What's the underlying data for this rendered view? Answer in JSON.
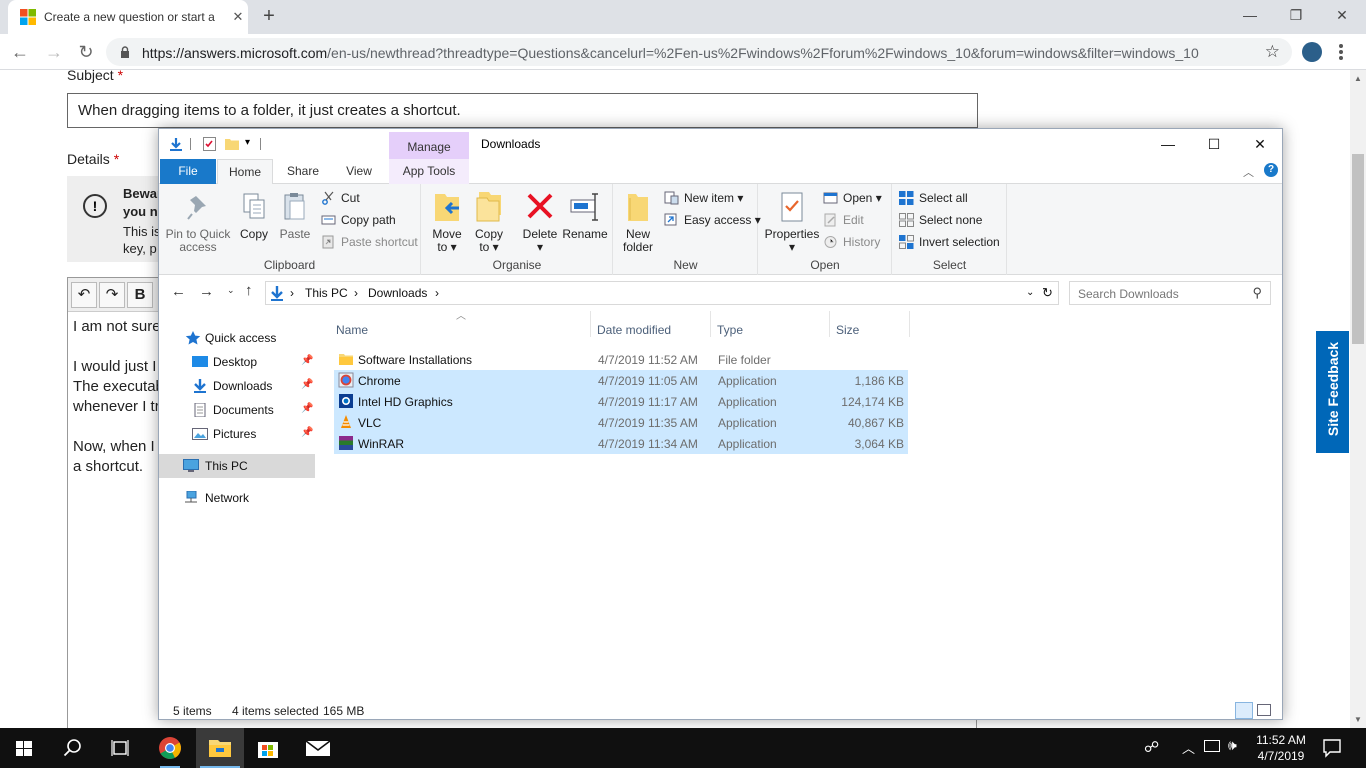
{
  "browser": {
    "tab_title": "Create a new question or start a",
    "url_host": "https://answers.microsoft.com",
    "url_path": "/en-us/newthread?threadtype=Questions&cancelurl=%2Fen-us%2Fwindows%2Fforum%2Fwindows_10&forum=windows&filter=windows_10"
  },
  "page": {
    "subject_label": "Subject",
    "required_mark": "*",
    "subject_value": "When dragging items to a folder, it just creates a shortcut.",
    "details_label": "Details",
    "warning_lines": [
      "Bewar",
      "you n",
      "This is",
      "key, p"
    ],
    "editor_lines": [
      "I am not sure",
      "I would just I",
      "The executab",
      "whenever I tr",
      "Now, when I",
      "a shortcut."
    ],
    "site_feedback": "Site Feedback"
  },
  "explorer": {
    "title": "Downloads",
    "context_tab": "Manage",
    "tabs": [
      "File",
      "Home",
      "Share",
      "View",
      "App Tools"
    ],
    "ribbon": {
      "clipboard": {
        "label": "Clipboard",
        "pin": "Pin to Quick access",
        "copy": "Copy",
        "paste": "Paste",
        "cut": "Cut",
        "copy_path": "Copy path",
        "paste_shortcut": "Paste shortcut"
      },
      "organise": {
        "label": "Organise",
        "move_to": "Move to",
        "copy_to": "Copy to",
        "delete": "Delete",
        "rename": "Rename"
      },
      "new": {
        "label": "New",
        "new_folder": "New folder",
        "new_item": "New item",
        "easy_access": "Easy access"
      },
      "open": {
        "label": "Open",
        "properties": "Properties",
        "open": "Open",
        "edit": "Edit",
        "history": "History"
      },
      "select": {
        "label": "Select",
        "select_all": "Select all",
        "select_none": "Select none",
        "invert": "Invert selection"
      }
    },
    "breadcrumb": [
      "This PC",
      "Downloads"
    ],
    "search_placeholder": "Search Downloads",
    "nav": {
      "quick_access": "Quick access",
      "items": [
        "Desktop",
        "Downloads",
        "Documents",
        "Pictures"
      ],
      "this_pc": "This PC",
      "network": "Network"
    },
    "columns": [
      "Name",
      "Date modified",
      "Type",
      "Size"
    ],
    "files": [
      {
        "name": "Software Installations",
        "date": "4/7/2019 11:52 AM",
        "type": "File folder",
        "size": "",
        "selected": false
      },
      {
        "name": "Chrome",
        "date": "4/7/2019 11:05 AM",
        "type": "Application",
        "size": "1,186 KB",
        "selected": true
      },
      {
        "name": "Intel HD Graphics",
        "date": "4/7/2019 11:17 AM",
        "type": "Application",
        "size": "124,174 KB",
        "selected": true
      },
      {
        "name": "VLC",
        "date": "4/7/2019 11:35 AM",
        "type": "Application",
        "size": "40,867 KB",
        "selected": true
      },
      {
        "name": "WinRAR",
        "date": "4/7/2019 11:34 AM",
        "type": "Application",
        "size": "3,064 KB",
        "selected": true
      }
    ],
    "status": {
      "count": "5 items",
      "selected": "4 items selected",
      "size": "165 MB"
    }
  },
  "taskbar": {
    "time": "11:52 AM",
    "date": "4/7/2019"
  }
}
